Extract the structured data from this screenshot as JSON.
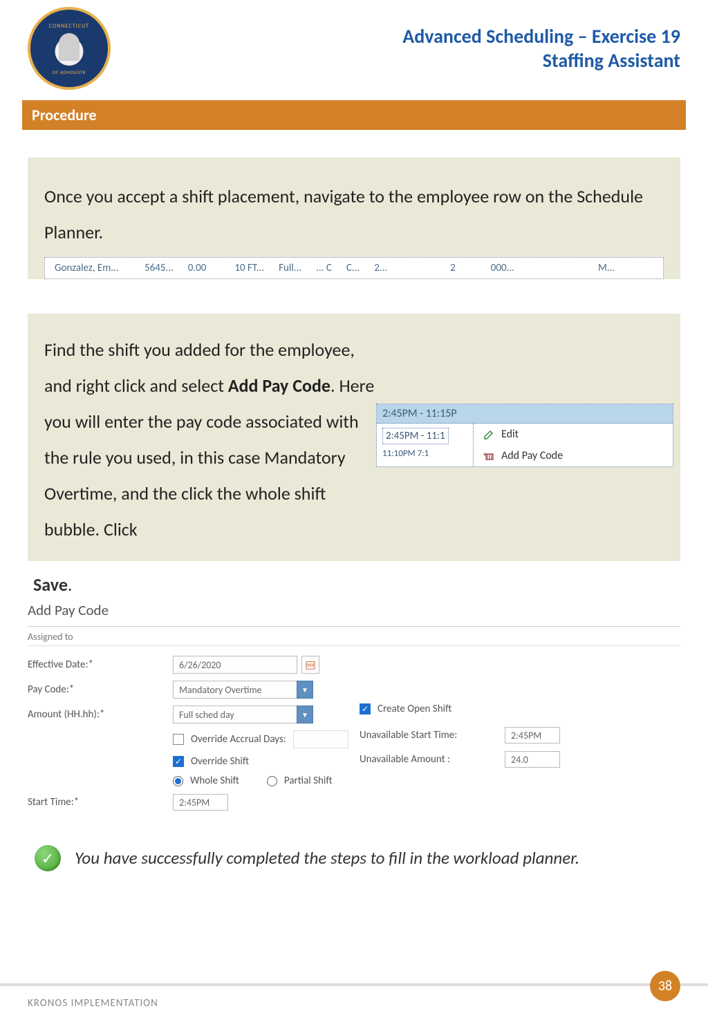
{
  "header": {
    "seal_top": "CONNECTICUT",
    "seal_bottom": "OF ADMINISTR",
    "title_line1": "Advanced Scheduling – Exercise 19",
    "title_line2": "Staffing Assistant"
  },
  "procedure_label": "Procedure",
  "step1": {
    "text": "Once you accept a shift placement, navigate to the employee row on the Schedule Planner.",
    "row": {
      "name": "Gonzalez, Em...",
      "c1": "5645...",
      "c2": "0.00",
      "c3": "10 FT...",
      "c4": "Full...",
      "c5": "... C",
      "c6": "C...",
      "c7": "2...",
      "c8": "2",
      "c9": "000...",
      "c10": "M..."
    }
  },
  "step2": {
    "text_pre": "Find the shift you added for the employee, and right click and select ",
    "text_bold1": "Add Pay Code",
    "text_mid": ". Here you will enter the pay code associated with the rule you used, in this case Mandatory Overtime, and the click the whole shift bubble. Click",
    "save": "Save",
    "dot": ".",
    "context": {
      "header": "2:45PM - 11:15P",
      "left1": "2:45PM - 11:1",
      "left2": "11:10PM   7:1",
      "edit": "Edit",
      "add": "Add Pay Code"
    }
  },
  "form": {
    "title": "Add Pay Code",
    "assigned": "Assigned to",
    "eff_date_label": "Effective Date:*",
    "eff_date_value": "6/26/2020",
    "paycode_label": "Pay Code:*",
    "paycode_value": "Mandatory Overtime",
    "amount_label": "Amount (HH.hh):*",
    "amount_value": "Full sched day",
    "override_accrual": "Override Accrual Days:",
    "create_open": "Create Open Shift",
    "override_shift": "Override Shift",
    "unavail_start_label": "Unavailable Start Time:",
    "unavail_start_value": "2:45PM",
    "whole_shift": "Whole Shift",
    "partial_shift": "Partial Shift",
    "unavail_amount_label": "Unavailable Amount :",
    "unavail_amount_value": "24.0",
    "start_time_label": "Start Time:*",
    "start_time_value": "2:45PM"
  },
  "success": "You have successfully completed the steps to fill in the workload planner.",
  "footer": "KRONOS IMPLEMENTATION",
  "page": "38"
}
